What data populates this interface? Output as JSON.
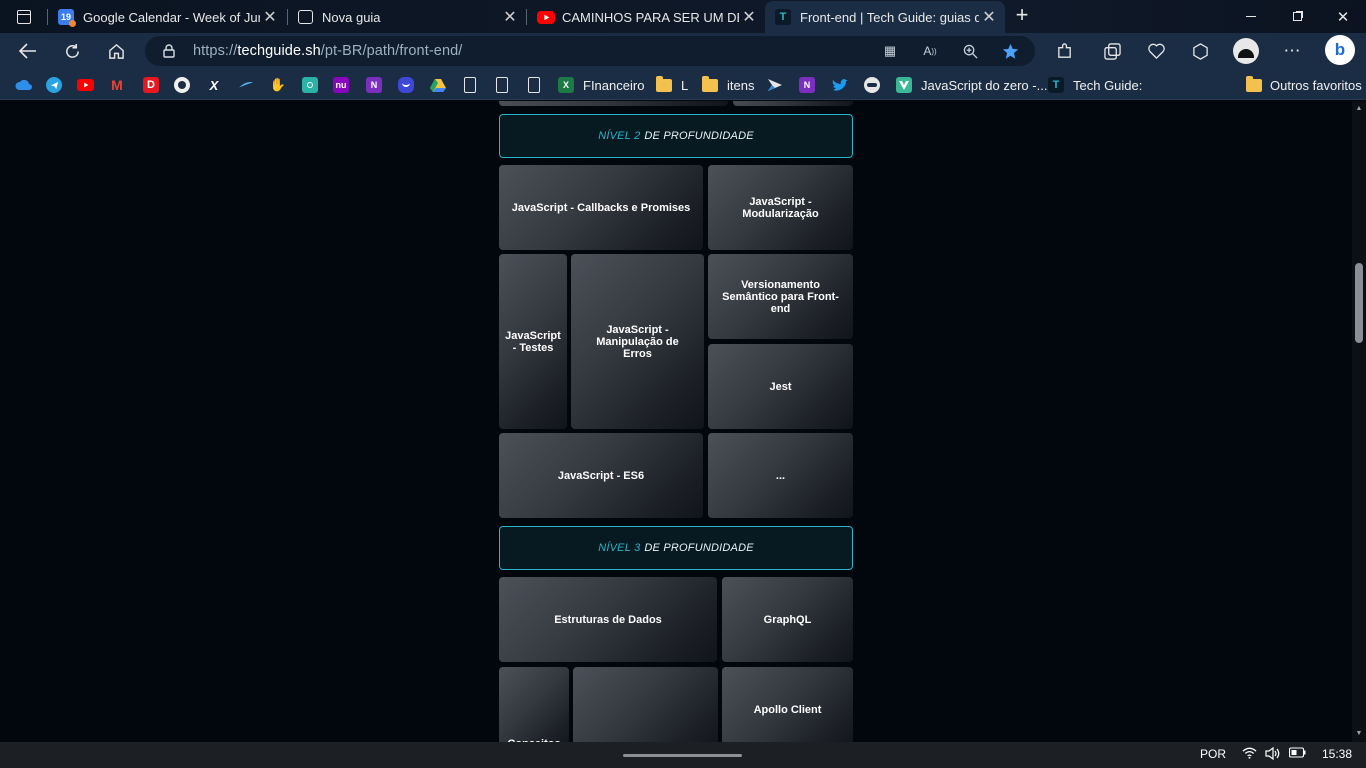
{
  "tabs": [
    {
      "title": "Google Calendar - Week of June",
      "favicon": "calendar-icon",
      "favicon_text": "19"
    },
    {
      "title": "Nova guia",
      "favicon": "new-tab-icon"
    },
    {
      "title": "CAMINHOS PARA SER UM DEV FR",
      "favicon": "youtube-icon"
    },
    {
      "title": "Front-end | Tech Guide: guias do",
      "favicon": "techguide-icon",
      "favicon_text": "T"
    }
  ],
  "address_bar": {
    "url_prefix": "https://",
    "url_host": "techguide.sh",
    "url_path": "/pt-BR/path/front-end/"
  },
  "bookmarks": [
    {
      "icon": "onedrive-icon",
      "label": ""
    },
    {
      "icon": "telegram-icon",
      "label": ""
    },
    {
      "icon": "youtube-icon",
      "label": ""
    },
    {
      "icon": "gmail-icon",
      "label": "",
      "icon_text": "M"
    },
    {
      "icon": "d-icon",
      "label": "",
      "icon_text": "D"
    },
    {
      "icon": "github-icon",
      "label": ""
    },
    {
      "icon": "x-icon",
      "label": "",
      "icon_text": "X"
    },
    {
      "icon": "bird-icon",
      "label": ""
    },
    {
      "icon": "hand-icon",
      "label": ""
    },
    {
      "icon": "meet-icon",
      "label": ""
    },
    {
      "icon": "nubank-icon",
      "label": "",
      "icon_text": "nu"
    },
    {
      "icon": "onenote-icon",
      "label": "",
      "icon_text": "N"
    },
    {
      "icon": "discord-icon",
      "label": ""
    },
    {
      "icon": "drive-icon",
      "label": ""
    },
    {
      "icon": "doc-icon",
      "label": ""
    },
    {
      "icon": "doc-icon",
      "label": ""
    },
    {
      "icon": "doc-icon",
      "label": ""
    },
    {
      "icon": "excel-icon",
      "label": "FInanceiro",
      "icon_text": "X"
    },
    {
      "icon": "folder-icon",
      "label": "L"
    },
    {
      "icon": "folder-icon",
      "label": "itens"
    },
    {
      "icon": "arrow-icon",
      "label": ""
    },
    {
      "icon": "onenote-icon",
      "label": "",
      "icon_text": "N"
    },
    {
      "icon": "twitter-icon",
      "label": ""
    },
    {
      "icon": "globe-icon",
      "label": ""
    },
    {
      "icon": "vue-icon",
      "label": "JavaScript do zero -..."
    },
    {
      "icon": "techguide-icon",
      "label": "Tech Guide:",
      "icon_text": "T"
    },
    {
      "icon": "folder-icon",
      "label": "Outros favoritos"
    }
  ],
  "levels": {
    "level2": {
      "accent": "NÍVEL 2",
      "rest": "DE PROFUNDIDADE"
    },
    "level3": {
      "accent": "NÍVEL 3",
      "rest": "DE PROFUNDIDADE"
    }
  },
  "cards": {
    "callbacks": "JavaScript - Callbacks e Promises",
    "modularizacao": "JavaScript - Modularização",
    "testes": "JavaScript - Testes",
    "erros": "JavaScript - Manipulação de Erros",
    "versionamento": "Versionamento Semântico para Front-end",
    "jest": "Jest",
    "es6": "JavaScript - ES6",
    "more": "...",
    "estruturas": "Estruturas de Dados",
    "graphql": "GraphQL",
    "conceitos": "Conceitos",
    "blank": "",
    "apollo": "Apollo Client"
  },
  "taskbar": {
    "language": "POR",
    "time": "15:38"
  },
  "colors": {
    "accent": "#29b4c8",
    "page_bg": "#02070d",
    "browser_chrome": "#1b2d44"
  }
}
